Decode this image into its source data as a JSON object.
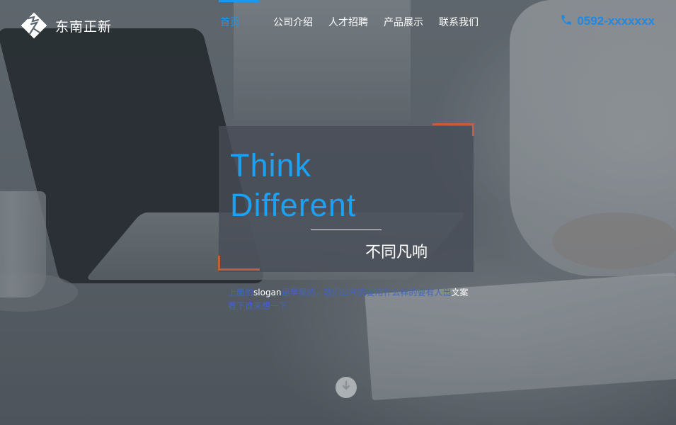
{
  "brand": {
    "name": "东南正新"
  },
  "nav": {
    "items": [
      {
        "label": "首页",
        "active": true
      },
      {
        "label": "公司介绍",
        "active": false
      },
      {
        "label": "人才招聘",
        "active": false
      },
      {
        "label": "产品展示",
        "active": false
      },
      {
        "label": "联系我们",
        "active": false
      }
    ]
  },
  "contact": {
    "phone": "0592-xxxxxxx",
    "icon": "phone-icon"
  },
  "hero": {
    "title_line1": "Think",
    "title_line2": "Different",
    "subtitle": "不同凡响",
    "description": {
      "part1": "上面的",
      "part2": "slogan",
      "part3": "是苹果的，我们公司的要用什么样的要有人出",
      "part4": "文案",
      "part5": "看下谁来想一下"
    }
  },
  "colors": {
    "accent": "#2196e6",
    "corner": "#c0603a",
    "desc": "#4464c0"
  },
  "scroll": {
    "icon": "arrow-down-icon"
  }
}
